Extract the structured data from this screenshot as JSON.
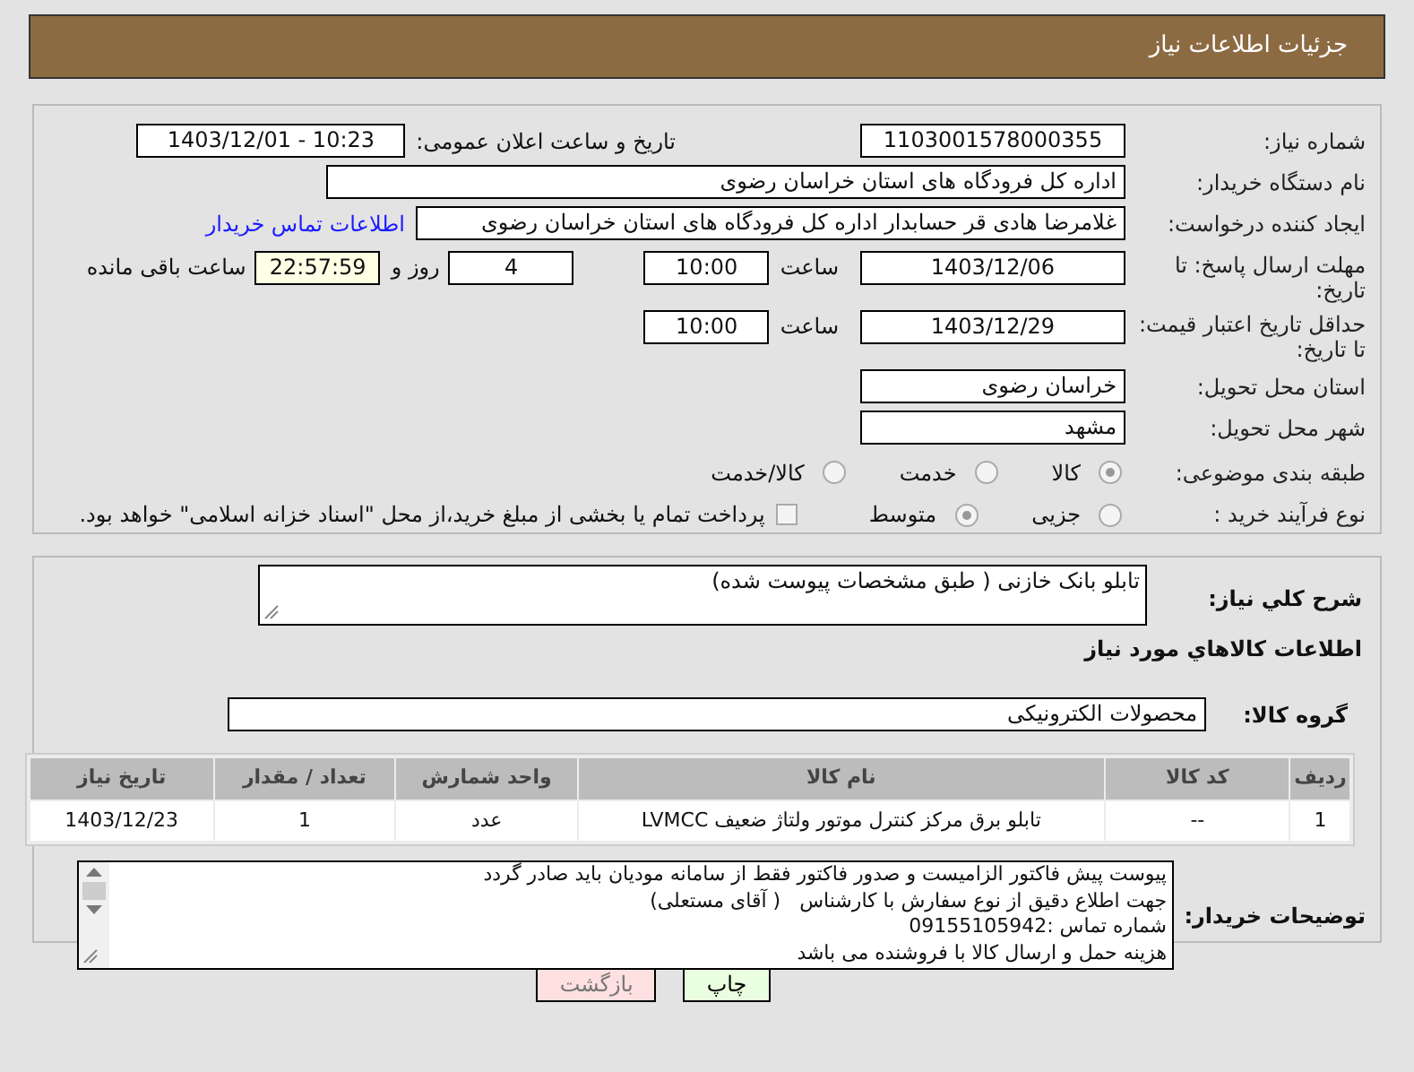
{
  "header": {
    "title": "جزئیات اطلاعات نیاز"
  },
  "need_number": {
    "label": "شماره نیاز:",
    "value": "1103001578000355"
  },
  "announce": {
    "label": "تاریخ و ساعت اعلان عمومی:",
    "value": "1403/12/01 - 10:23"
  },
  "buyer_org": {
    "label": "نام دستگاه خریدار:",
    "value": "اداره کل فرودگاه های استان خراسان رضوی"
  },
  "requester": {
    "label": "ایجاد کننده درخواست:",
    "value": "غلامرضا هادی قر حسابدار اداره کل فرودگاه های استان خراسان رضوی",
    "link": "اطلاعات تماس خریدار"
  },
  "reply_deadline": {
    "label": "مهلت ارسال پاسخ: تا تاریخ:",
    "date": "1403/12/06",
    "time_label": "ساعت",
    "time": "10:00",
    "days": "4",
    "days_label": "روز و",
    "remaining": "22:57:59",
    "remaining_label": "ساعت باقی مانده"
  },
  "price_validity": {
    "label": "حداقل تاریخ اعتبار قیمت: تا تاریخ:",
    "date": "1403/12/29",
    "time_label": "ساعت",
    "time": "10:00"
  },
  "province": {
    "label": "استان محل تحویل:",
    "value": "خراسان رضوی"
  },
  "city": {
    "label": "شهر محل تحویل:",
    "value": "مشهد"
  },
  "category": {
    "label": "طبقه بندی موضوعی:",
    "options": [
      {
        "label": "کالا",
        "selected": true
      },
      {
        "label": "خدمت",
        "selected": false
      },
      {
        "label": "کالا/خدمت",
        "selected": false
      }
    ]
  },
  "process": {
    "label": "نوع فرآیند خرید :",
    "options": [
      {
        "label": "جزیی",
        "selected": false
      },
      {
        "label": "متوسط",
        "selected": true
      }
    ],
    "treasury": {
      "label": "پرداخت تمام یا بخشی از مبلغ خرید،از محل \"اسناد خزانه اسلامی\" خواهد بود.",
      "checked": false
    }
  },
  "summary": {
    "label": "شرح کلي نياز:",
    "value": "تابلو بانک خازنی ( طبق مشخصات پیوست شده)"
  },
  "goods_heading": "اطلاعات کالاهاي مورد نياز",
  "goods_group": {
    "label": "گروه کالا:",
    "value": "محصولات الکترونیکی"
  },
  "table": {
    "columns": [
      "ردیف",
      "کد کالا",
      "نام کالا",
      "واحد شمارش",
      "تعداد / مقدار",
      "تاریخ نیاز"
    ],
    "rows": [
      [
        "1",
        "--",
        "تابلو برق مرکز کنترل موتور ولتاژ ضعیف LVMCC",
        "عدد",
        "1",
        "1403/12/23"
      ]
    ]
  },
  "buyer_notes": {
    "label": "توضیحات خریدار:",
    "lines": [
      "پیوست پیش فاکتور الزامیست و صدور فاکتور فقط از سامانه مودیان باید صادر گردد",
      "جهت اطلاع دقیق از نوع سفارش با کارشناس   ( آقای مستعلی)",
      "شماره تماس :09155105942",
      "هزینه حمل و ارسال کالا با فروشنده می باشد"
    ]
  },
  "buttons": [
    {
      "label": "چاپ",
      "kind": "print"
    },
    {
      "label": "بازگشت",
      "kind": "back"
    }
  ]
}
